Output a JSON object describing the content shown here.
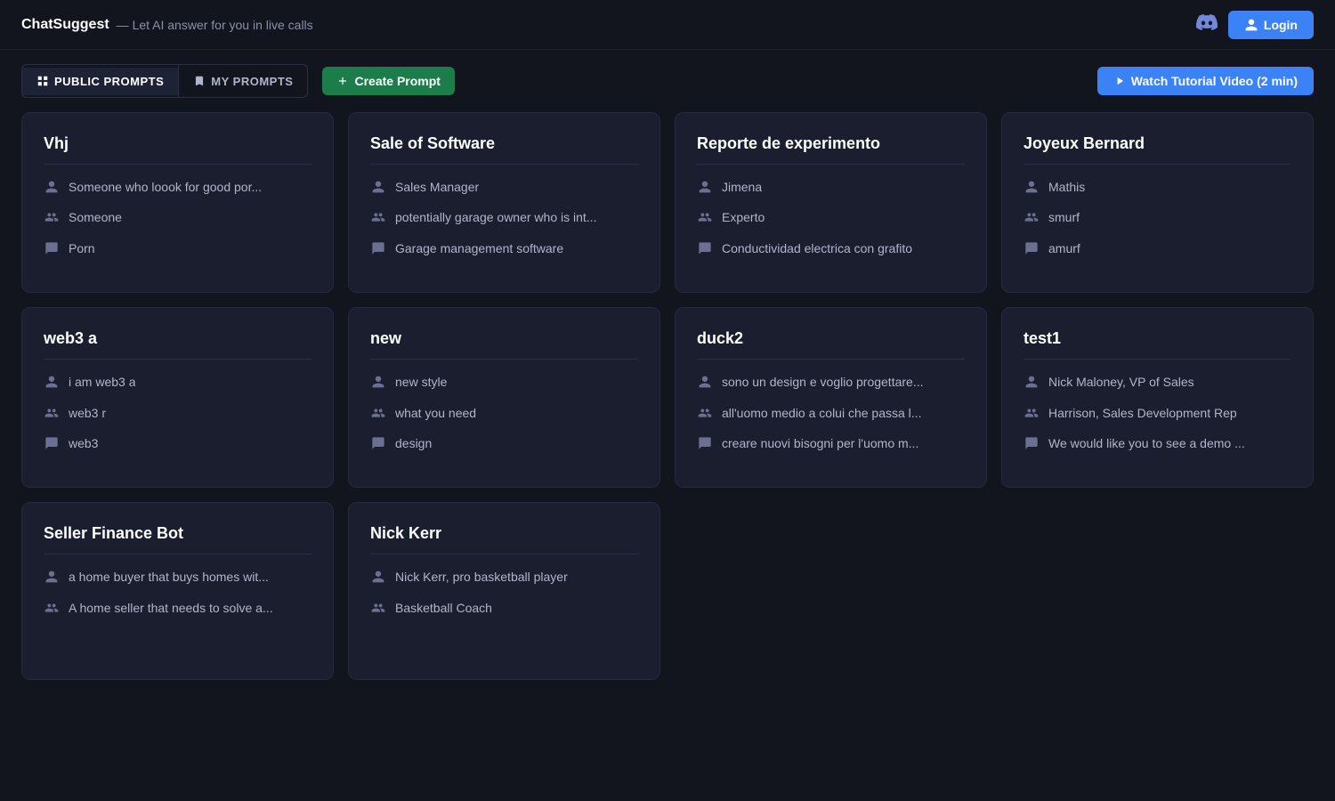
{
  "header": {
    "title": "ChatSuggest",
    "separator": "—",
    "subtitle": "Let AI answer for you in live calls",
    "login_label": "Login"
  },
  "toolbar": {
    "public_prompts_label": "PUBLIC PROMPTS",
    "my_prompts_label": "MY PROMPTS",
    "create_label": "Create Prompt",
    "watch_label": "Watch Tutorial Video (2 min)"
  },
  "cards": [
    {
      "title": "Vhj",
      "person_icon1": "👤",
      "person_icon2": "👥",
      "chat_icon": "💬",
      "row1": "Someone who loook for good por...",
      "row2": "Someone",
      "row3": "Porn"
    },
    {
      "title": "Sale of Software",
      "row1": "Sales Manager",
      "row2": "potentially garage owner who is int...",
      "row3": "Garage management software"
    },
    {
      "title": "Reporte de experimento",
      "row1": "Jimena",
      "row2": "Experto",
      "row3": "Conductividad electrica con grafito"
    },
    {
      "title": "Joyeux Bernard",
      "row1": "Mathis",
      "row2": "smurf",
      "row3": "amurf"
    },
    {
      "title": "web3 a",
      "row1": "i am web3 a",
      "row2": "web3 r",
      "row3": "web3"
    },
    {
      "title": "new",
      "row1": "new style",
      "row2": "what you need",
      "row3": "design"
    },
    {
      "title": "duck2",
      "row1": "sono un design e voglio progettare...",
      "row2": "all'uomo medio a colui che passa l...",
      "row3": "creare nuovi bisogni per l'uomo m..."
    },
    {
      "title": "test1",
      "row1": "Nick Maloney, VP of Sales",
      "row2": "Harrison, Sales Development Rep",
      "row3": "We would like you to see a demo ..."
    },
    {
      "title": "Seller Finance Bot",
      "row1": "a home buyer that buys homes wit...",
      "row2": "A home seller that needs to solve a...",
      "row3": ""
    },
    {
      "title": "Nick Kerr",
      "row1": "Nick Kerr, pro basketball player",
      "row2": "Basketball Coach",
      "row3": ""
    }
  ]
}
